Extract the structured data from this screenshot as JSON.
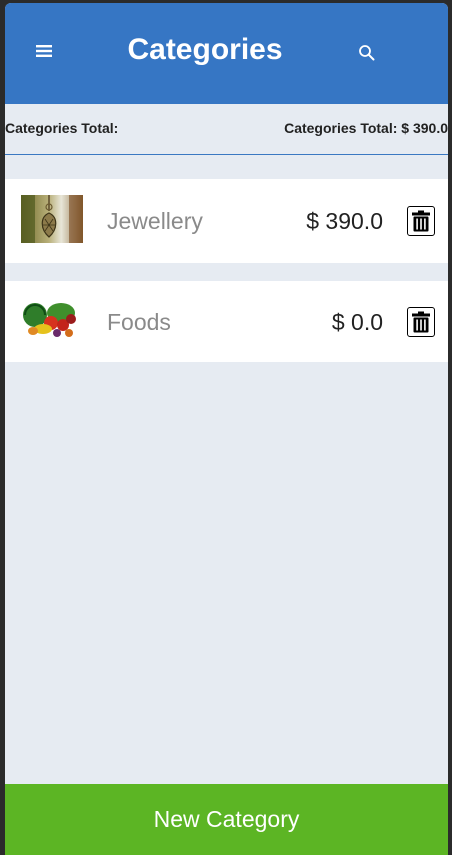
{
  "header": {
    "title": "Categories",
    "menu_icon": "hamburger-menu-icon",
    "search_icon": "search-icon",
    "background": "#3676c4"
  },
  "summary": {
    "left_label": "Categories Total:",
    "right_label": "Categories Total: $ 390.0"
  },
  "categories": [
    {
      "name": "Jewellery",
      "amount": "$ 390.0",
      "image": "pendant-jewellery-thumbnail",
      "delete_icon": "trash-icon"
    },
    {
      "name": "Foods",
      "amount": "$ 0.0",
      "image": "fruits-vegetables-thumbnail",
      "delete_icon": "trash-icon"
    }
  ],
  "footer": {
    "new_category_label": "New Category",
    "background": "#5cb524"
  }
}
